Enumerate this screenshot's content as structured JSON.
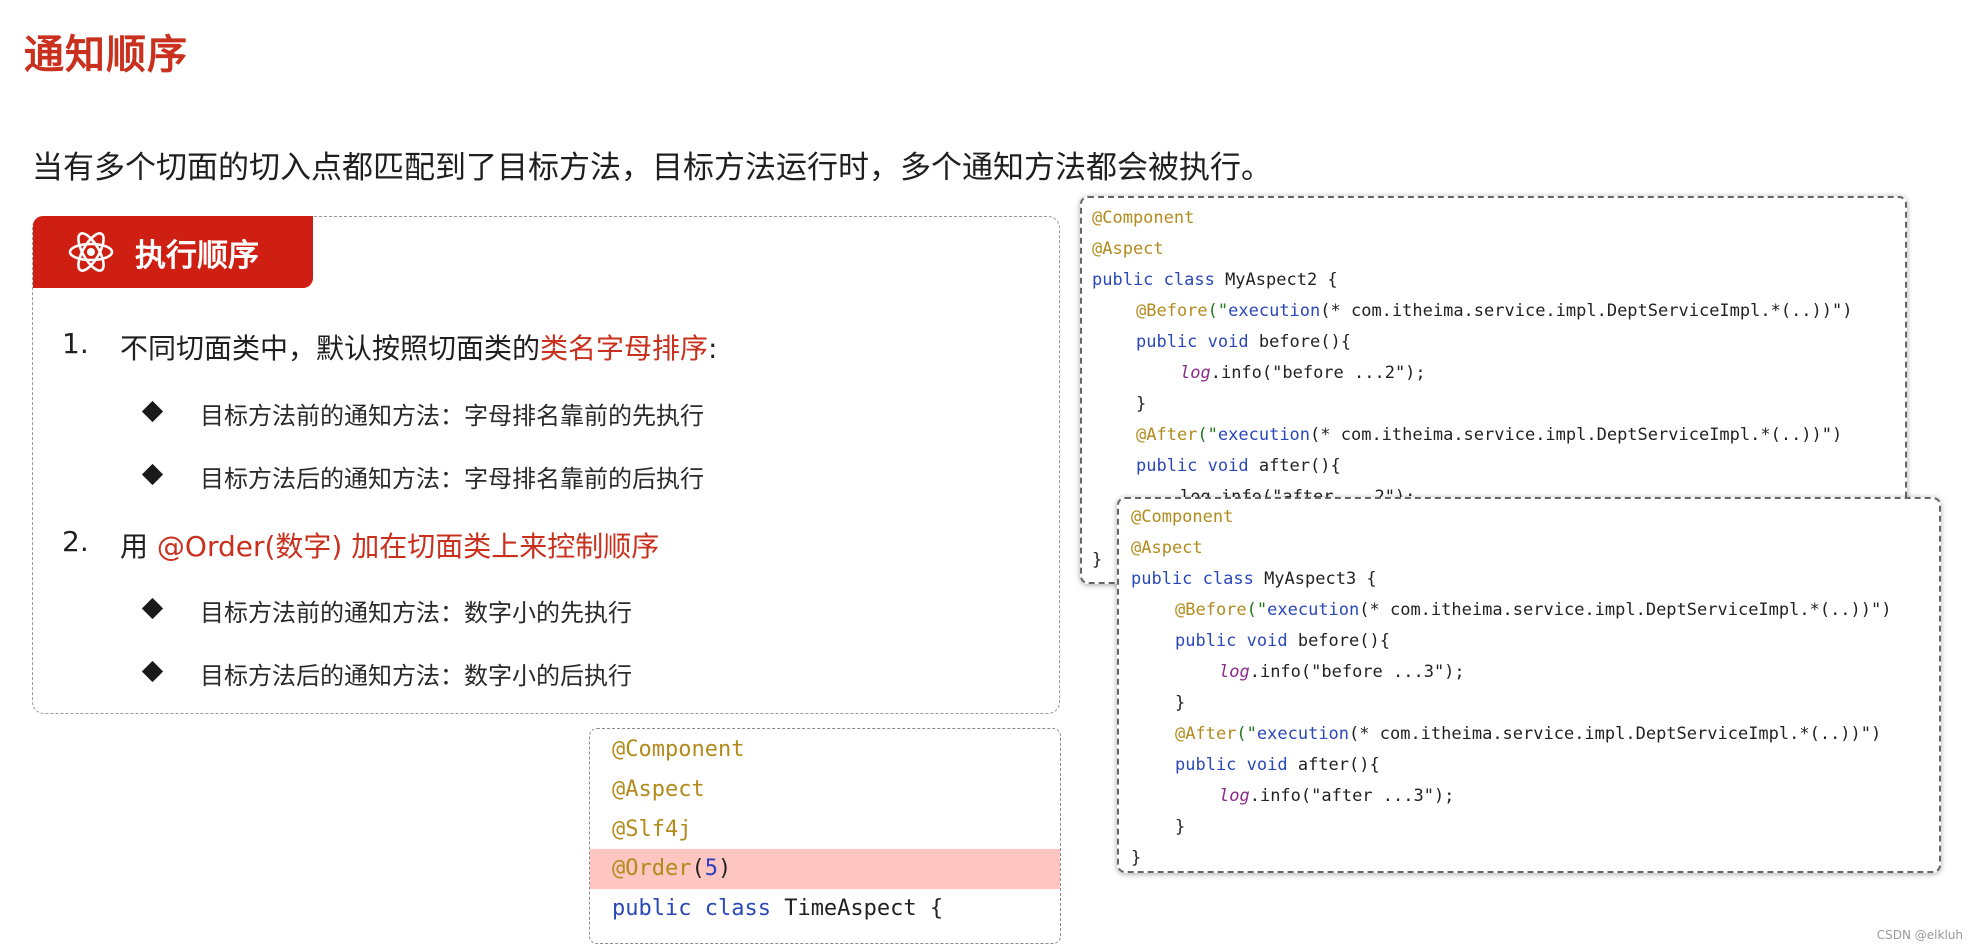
{
  "page": {
    "title": "通知顺序",
    "subtitle": "当有多个切面的切入点都匹配到了目标方法，目标方法运行时，多个通知方法都会被执行。",
    "watermark": "CSDN @elkluh"
  },
  "panel": {
    "header": "执行顺序",
    "header_icon": "atom-icon",
    "item1": {
      "num": "1.",
      "text": "不同切面类中，默认按照切面类的",
      "highlight": "类名字母排序",
      "tail": ":"
    },
    "item1_subs": [
      "目标方法前的通知方法：字母排名靠前的先执行",
      "目标方法后的通知方法：字母排名靠前的后执行"
    ],
    "item2": {
      "num": "2.",
      "text": "用 ",
      "highlight": "@Order(数字) 加在切面类上来控制顺序"
    },
    "item2_subs": [
      "目标方法前的通知方法：数字小的先执行",
      "目标方法后的通知方法：数字小的后执行"
    ]
  },
  "code_aspect2": {
    "l1": "@Component",
    "l2": "@Aspect",
    "l3_kw": "public class",
    "l3_name": " MyAspect2 {",
    "l4_ann": "@Before",
    "l4_open": "(\"",
    "l4_exec": "execution",
    "l4_rest": "(* com.itheima.service.impl.DeptServiceImpl.*(..))\")",
    "l5_kw": "public void",
    "l5_rest": " before(){",
    "l6_log": "log",
    "l6_rest": ".info(\"before ...2\");",
    "l7": "}",
    "l8_ann": "@After",
    "l8_open": "(\"",
    "l8_exec": "execution",
    "l8_rest": "(* com.itheima.service.impl.DeptServiceImpl.*(..))\")",
    "l9_kw": "public void",
    "l9_rest": " after(){",
    "l10": "log.info(\"after ...2\");",
    "l11": "}"
  },
  "code_aspect3": {
    "l1": "@Component",
    "l2": "@Aspect",
    "l3_kw": "public class",
    "l3_name": " MyAspect3 {",
    "l4_ann": "@Before",
    "l4_open": "(\"",
    "l4_exec": "execution",
    "l4_rest": "(* com.itheima.service.impl.DeptServiceImpl.*(..))\")",
    "l5_kw": "public void",
    "l5_rest": " before(){",
    "l6_log": "log",
    "l6_rest": ".info(\"before ...3\");",
    "l7": "}",
    "l8_ann": "@After",
    "l8_open": "(\"",
    "l8_exec": "execution",
    "l8_rest": "(* com.itheima.service.impl.DeptServiceImpl.*(..))\")",
    "l9_kw": "public void",
    "l9_rest": " after(){",
    "l10_log": "log",
    "l10_rest": ".info(\"after ...3\");",
    "l11": "}",
    "l12": "}"
  },
  "code_time": {
    "l1": "@Component",
    "l2": "@Aspect",
    "l3": "@Slf4j",
    "l4_ann": "@Order",
    "l4_open": "(",
    "l4_num": "5",
    "l4_close": ")",
    "l5_kw": "public class",
    "l5_name": " TimeAspect {"
  }
}
